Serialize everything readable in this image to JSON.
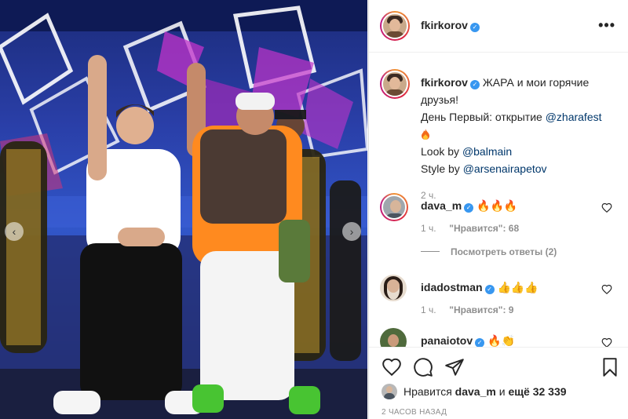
{
  "post": {
    "username": "fkirkorov",
    "more_label": "•••",
    "prev_label": "‹",
    "next_label": "›"
  },
  "caption": {
    "username": "fkirkorov",
    "line1": "ЖАРА и мои горячие друзья!",
    "line2": "День Первый: открытие ",
    "mention_fest": "@zharafest",
    "look_prefix": "Look by ",
    "mention_look": "@balmain",
    "style_prefix": "Style by ",
    "mention_style": "@arsenairapetov",
    "time": "2 ч."
  },
  "comments": [
    {
      "username": "dava_m",
      "emoji": "🔥🔥🔥",
      "time": "1 ч.",
      "likes": "\"Нравится\": 68",
      "replies": "Посмотреть ответы (2)"
    },
    {
      "username": "idadostman",
      "emoji": "👍👍👍",
      "time": "1 ч.",
      "likes": "\"Нравится\": 9"
    },
    {
      "username": "panaiotov",
      "emoji": "🔥👏"
    }
  ],
  "likes": {
    "prefix": "Нравится ",
    "user": "dava_m",
    "middle": " и ",
    "count": "ещё 32 339"
  },
  "timestamp": "2 ЧАСОВ НАЗАД",
  "colors": {
    "verified": "#3897f0",
    "link": "#00376b",
    "meta": "#8e8e8e"
  },
  "icons": [
    "more-options-icon",
    "verified-icon",
    "heart-icon",
    "comment-icon",
    "share-icon",
    "bookmark-icon",
    "flame-icon"
  ]
}
